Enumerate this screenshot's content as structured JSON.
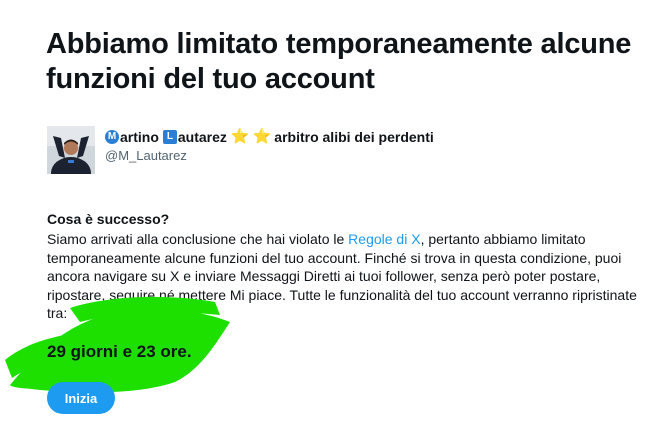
{
  "title": "Abbiamo limitato temporaneamente alcune funzioni del tuo account",
  "user": {
    "name_badge_1": "M",
    "name_part_1": "artino",
    "name_badge_2": "L",
    "name_part_2": "autarez",
    "star_1": "⭐",
    "star_2": "⭐",
    "bio_suffix": "arbitro alibi dei perdenti",
    "handle": "@M_Lautarez",
    "avatar_icon": "profile-photo"
  },
  "section": {
    "heading": "Cosa è successo?",
    "text_before_link": "Siamo arrivati alla conclusione che hai violato le ",
    "link_text": "Regole di X",
    "text_after_link": ", pertanto abbiamo limitato temporaneamente alcune funzioni del tuo account. Finché si trova in questa condizione, puoi ancora navigare su X e inviare Messaggi Diretti ai tuoi follower, senza però poter postare, ripostare, seguire né mettere Mi piace. Tutte le funzionalità del tuo account verranno ripristinate tra:"
  },
  "duration": "29 giorni e 23 ore.",
  "start_button_label": "Inizia",
  "colors": {
    "link": "#1d9bf0",
    "button": "#1d9bf0",
    "highlight": "#1ee000",
    "badge": "#2a7fd4"
  }
}
